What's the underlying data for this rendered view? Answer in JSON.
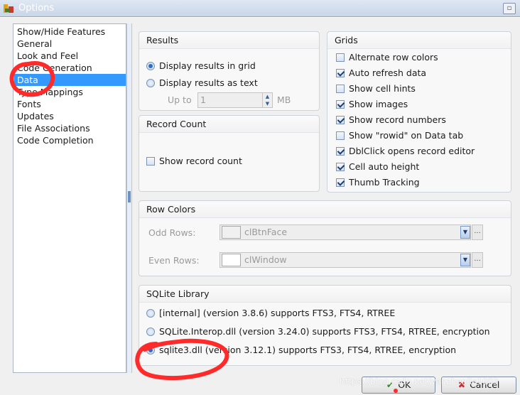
{
  "window": {
    "title": "Options",
    "restore_glyph": "▫"
  },
  "nav": {
    "items": [
      "Show/Hide Features",
      "General",
      "Look and Feel",
      "Code Generation",
      "Data",
      "Type Mappings",
      "Fonts",
      "Updates",
      "File Associations",
      "Code Completion"
    ],
    "selected": "Data"
  },
  "results": {
    "title": "Results",
    "grid_label": "Display results in grid",
    "grid_selected": true,
    "text_label": "Display results as text",
    "text_selected": false,
    "upto_label": "Up to",
    "upto_value": "1",
    "unit": "MB"
  },
  "grids": {
    "title": "Grids",
    "options": [
      {
        "label": "Alternate row colors",
        "checked": false
      },
      {
        "label": "Auto refresh data",
        "checked": true
      },
      {
        "label": "Show cell hints",
        "checked": false
      },
      {
        "label": "Show images",
        "checked": true
      },
      {
        "label": "Show record numbers",
        "checked": true
      },
      {
        "label": "Show \"rowid\" on Data tab",
        "checked": false
      },
      {
        "label": "DblClick opens record editor",
        "checked": true
      },
      {
        "label": "Cell auto height",
        "checked": true
      },
      {
        "label": "Thumb Tracking",
        "checked": true
      }
    ]
  },
  "record_count": {
    "title": "Record Count",
    "show_label": "Show record count",
    "show_checked": false
  },
  "row_colors": {
    "title": "Row Colors",
    "odd_label": "Odd Rows:",
    "odd_value": "clBtnFace",
    "odd_color": "#f0f0f0",
    "even_label": "Even Rows:",
    "even_value": "clWindow",
    "even_color": "#ffffff",
    "ellipsis": "..."
  },
  "sqlite": {
    "title": "SQLite Library",
    "options": [
      {
        "label": "[internal] (version 3.8.6) supports FTS3, FTS4, RTREE",
        "selected": false
      },
      {
        "label": "SQLite.Interop.dll (version 3.24.0) supports FTS3, FTS4, RTREE, encryption",
        "selected": false
      },
      {
        "label": "sqlite3.dll (version 3.12.1) supports FTS3, FTS4, RTREE, encryption",
        "selected": true
      }
    ]
  },
  "buttons": {
    "ok": "OK",
    "cancel": "Cancel"
  },
  "watermark": "https://blog.csdn.net/yanzhenjie1003",
  "colors": {
    "selection": "#3399ff",
    "annotation": "#ff2a2a"
  }
}
